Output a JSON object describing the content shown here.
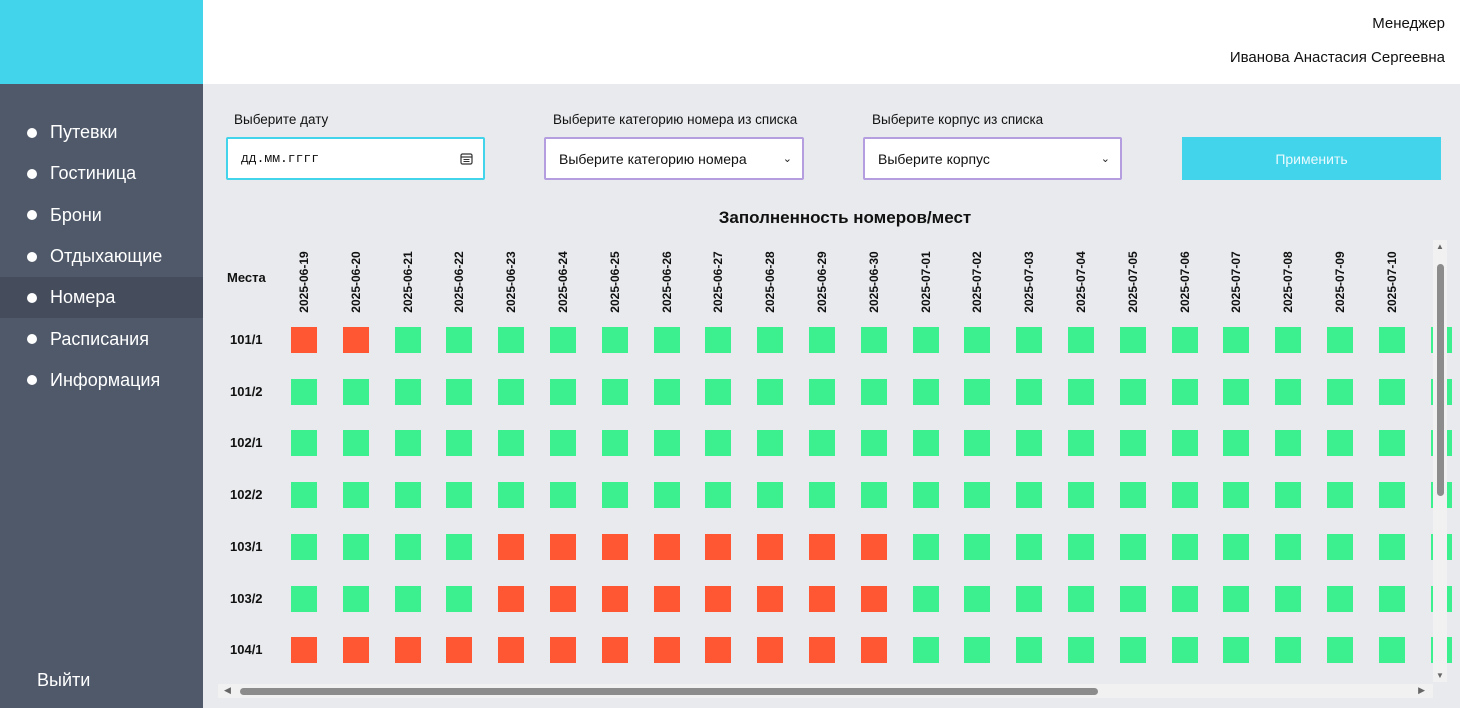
{
  "sidebar": {
    "items": [
      {
        "label": "Путевки",
        "active": false
      },
      {
        "label": "Гостиница",
        "active": false
      },
      {
        "label": "Брони",
        "active": false
      },
      {
        "label": "Отдыхающие",
        "active": false
      },
      {
        "label": "Номера",
        "active": true
      },
      {
        "label": "Расписания",
        "active": false
      },
      {
        "label": "Информация",
        "active": false
      }
    ],
    "logout_label": "Выйти"
  },
  "header": {
    "role": "Менеджер",
    "user_name": "Иванова Анастасия Сергеевна"
  },
  "filters": {
    "date_label": "Выберите дату",
    "date_placeholder": "дд.мм.гггг",
    "category_label": "Выберите категорию номера из списка",
    "category_value": "Выберите категорию номера",
    "building_label": "Выберите корпус из списка",
    "building_value": "Выберите корпус",
    "apply_label": "Применить"
  },
  "grid": {
    "title": "Заполненность номеров/мест",
    "places_header": "Места",
    "dates": [
      "2025-06-19",
      "2025-06-20",
      "2025-06-21",
      "2025-06-22",
      "2025-06-23",
      "2025-06-24",
      "2025-06-25",
      "2025-06-26",
      "2025-06-27",
      "2025-06-28",
      "2025-06-29",
      "2025-06-30",
      "2025-07-01",
      "2025-07-02",
      "2025-07-03",
      "2025-07-04",
      "2025-07-05",
      "2025-07-06",
      "2025-07-07",
      "2025-07-08",
      "2025-07-09",
      "2025-07-10"
    ],
    "rows": [
      {
        "place": "101/1",
        "cells": [
          1,
          1,
          0,
          0,
          0,
          0,
          0,
          0,
          0,
          0,
          0,
          0,
          0,
          0,
          0,
          0,
          0,
          0,
          0,
          0,
          0,
          0
        ]
      },
      {
        "place": "101/2",
        "cells": [
          0,
          0,
          0,
          0,
          0,
          0,
          0,
          0,
          0,
          0,
          0,
          0,
          0,
          0,
          0,
          0,
          0,
          0,
          0,
          0,
          0,
          0
        ]
      },
      {
        "place": "102/1",
        "cells": [
          0,
          0,
          0,
          0,
          0,
          0,
          0,
          0,
          0,
          0,
          0,
          0,
          0,
          0,
          0,
          0,
          0,
          0,
          0,
          0,
          0,
          0
        ]
      },
      {
        "place": "102/2",
        "cells": [
          0,
          0,
          0,
          0,
          0,
          0,
          0,
          0,
          0,
          0,
          0,
          0,
          0,
          0,
          0,
          0,
          0,
          0,
          0,
          0,
          0,
          0
        ]
      },
      {
        "place": "103/1",
        "cells": [
          0,
          0,
          0,
          0,
          1,
          1,
          1,
          1,
          1,
          1,
          1,
          1,
          0,
          0,
          0,
          0,
          0,
          0,
          0,
          0,
          0,
          0
        ]
      },
      {
        "place": "103/2",
        "cells": [
          0,
          0,
          0,
          0,
          1,
          1,
          1,
          1,
          1,
          1,
          1,
          1,
          0,
          0,
          0,
          0,
          0,
          0,
          0,
          0,
          0,
          0
        ]
      },
      {
        "place": "104/1",
        "cells": [
          1,
          1,
          1,
          1,
          1,
          1,
          1,
          1,
          1,
          1,
          1,
          1,
          0,
          0,
          0,
          0,
          0,
          0,
          0,
          0,
          0,
          0
        ]
      }
    ],
    "colors": {
      "free": "#3cf08f",
      "busy": "#ff5733"
    }
  }
}
